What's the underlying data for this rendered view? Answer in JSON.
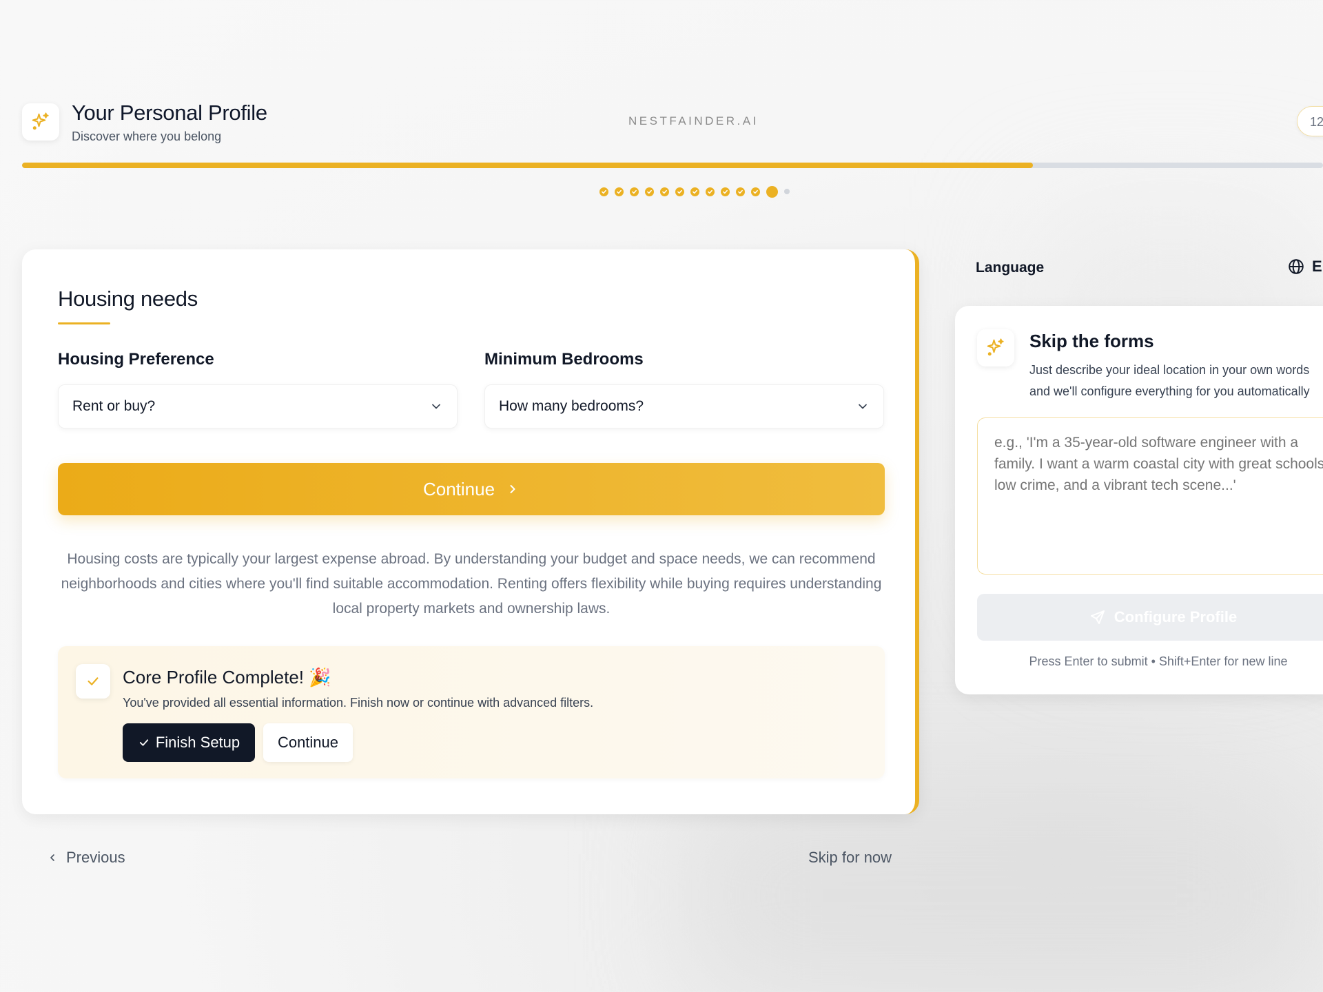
{
  "header": {
    "title": "Your Personal Profile",
    "subtitle": "Discover where you belong",
    "brand": "NESTFAINDER.AI",
    "counter": "12",
    "icon": "sparkles-icon"
  },
  "progress": {
    "fraction": 0.777,
    "completed_steps": 11,
    "current_step": 12,
    "total_steps": 13
  },
  "section": {
    "title": "Housing needs",
    "housing_preference": {
      "label": "Housing Preference",
      "value": "Rent or buy?"
    },
    "minimum_bedrooms": {
      "label": "Minimum Bedrooms",
      "value": "How many bedrooms?"
    },
    "continue_label": "Continue",
    "info": "Housing costs are typically your largest expense abroad. By understanding your budget and space needs, we can recommend neighborhoods and cities where you'll find suitable accommodation. Renting offers flexibility while buying requires understanding local property markets and ownership laws."
  },
  "complete": {
    "title": "Core Profile Complete! 🎉",
    "description": "You've provided all essential information. Finish now or continue with advanced filters.",
    "finish_label": "Finish Setup",
    "continue_label": "Continue"
  },
  "nav": {
    "previous_label": "Previous",
    "skip_label": "Skip for now"
  },
  "language": {
    "label": "Language",
    "value": "E"
  },
  "skip_forms": {
    "title": "Skip the forms",
    "desc_line1": "Just describe your ideal location in your own words",
    "desc_line2": "and we'll configure everything for you automatically",
    "placeholder": "e.g., 'I'm a 35-year-old software engineer with a family. I want a warm coastal city with great schools, low crime, and a vibrant tech scene...'",
    "configure_label": "Configure Profile",
    "hint": "Press Enter to submit • Shift+Enter for new line"
  },
  "colors": {
    "accent": "#ebb123",
    "dark": "#111827"
  }
}
